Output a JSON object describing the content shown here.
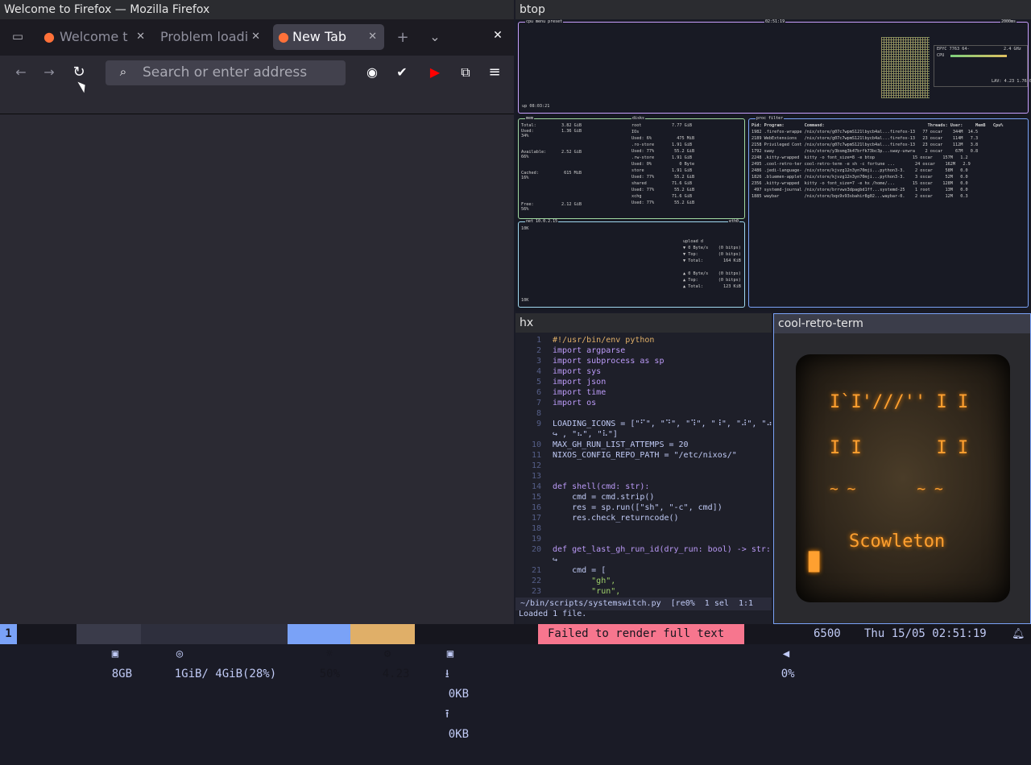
{
  "firefox": {
    "window_title": "Welcome to Firefox — Mozilla Firefox",
    "tabs": [
      {
        "label": "Welcome t",
        "active": false
      },
      {
        "label": "Problem loadi",
        "active": false
      },
      {
        "label": "New Tab",
        "active": true
      }
    ],
    "address_placeholder": "Search or enter address",
    "icons": [
      "tab-overview-icon",
      "firefox-icon",
      "close-icon",
      "new-tab-icon",
      "list-tabs-icon",
      "close-window-icon",
      "back-icon",
      "forward-icon",
      "reload-icon",
      "search-icon",
      "account-icon",
      "extension-icon",
      "youtube-icon",
      "puzzle-icon",
      "menu-icon"
    ]
  },
  "btop": {
    "window_title": "btop",
    "cpu": {
      "model": "EPYC 7763 64-",
      "freq": "2.4 GHz",
      "uptime": "up 08:03:21",
      "clock": "02:51:19",
      "load": "LAV: 4.23 1.76 0.60",
      "header_right": "2000ms"
    },
    "mem": {
      "lines": [
        "Total:          3.82 GiB",
        "Used:           1.36 GiB",
        "34%",
        "",
        "",
        "Available:      2.52 GiB",
        "66%",
        "",
        "",
        "Cached:          615 MiB",
        "16%",
        "",
        "",
        "",
        "",
        "Free:           2.12 GiB",
        "56%"
      ],
      "disks": [
        "root            7.77 GiB",
        "IOs",
        "Used: 6%          475 MiB",
        ".ro-store       1.91 GiB",
        "Used: 77%        55.2 GiB",
        ".rw-store       1.91 GiB",
        "Used: 0%           0 Byte",
        "store           1.91 GiB",
        "Used: 77%        55.2 GiB",
        "shared          71.6 GiB",
        "Used: 77%        55.2 GiB",
        "xchg            71.6 GiB",
        "Used: 77%        55.2 GiB"
      ]
    },
    "net": {
      "label": "net 10.0.2.15",
      "iface": "eth0",
      "scale_top": "10K",
      "scale_bottom": "10K",
      "lines": [
        "upload d",
        "▼ 0 Byte/s    (0 bitps)",
        "▼ Top:        (0 bitps)",
        "▼ Total:        164 KiB",
        "",
        "▲ 0 Byte/s    (0 bitps)",
        "▲ Top:        (0 bitps)",
        "▲ Total:        123 KiB"
      ]
    },
    "proc": {
      "header": "Pid: Program:        Command:                                         Threads: User:     MemB   Cpu%",
      "rows": [
        "1982 .firefox-wrappe /nix/store/g07c7wpmS121lbycb4al...firefox-13   77 oscar    344M  14.5",
        "2189 WebExtensions   /nix/store/g07c7wpmS121lbycb4al...firefox-13   23 oscar    114M   7.3",
        "2158 Privileged Cont /nix/store/g07c7wpmS121lbycb4al...firefox-13   23 oscar    112M   3.8",
        "1792 sway            /nix/store/y3bsmg3k47brfk73bc3p...sway-unwra    2 oscar     67M   0.8",
        "2248 .kitty-wrapped  kitty -o font_size=8 -e btop               15 oscar    157M   1.2",
        "2495 .cool-retro-ter cool-retro-term -e sh -c fortune ...        24 oscar    162M   2.9",
        "2486 .jedi-language- /nix/store/kjvzg12n3yn70mji...python3-3.    2 oscar     58M   0.0",
        "1826 .bluemen-applet /nix/store/kjvzg12n3yn70mji...python3-3.    3 oscar     52M   0.0",
        "2356 .kitty-wrapped  kitty -o font_size=7 -e hx /home/...       15 oscar    128M   0.0",
        " 497 systemd-journal /nix/store/brrvwx3dpagbd1ff...systemd-25    1 root      13M   0.0",
        "1885 waybar          /nix/store/bqs9v93sbahir8g02...waybar-0.    2 oscar     12M   0.3"
      ]
    }
  },
  "hx": {
    "window_title": "hx",
    "lines": [
      {
        "n": "1",
        "t": "#!/usr/bin/env python"
      },
      {
        "n": "2",
        "t": "import argparse"
      },
      {
        "n": "3",
        "t": "import subprocess as sp"
      },
      {
        "n": "4",
        "t": "import sys"
      },
      {
        "n": "5",
        "t": "import json"
      },
      {
        "n": "6",
        "t": "import time"
      },
      {
        "n": "7",
        "t": "import os"
      },
      {
        "n": "8",
        "t": ""
      },
      {
        "n": "9",
        "t": "LOADING_ICONS = [\"⠋\", \"⠙\", \"⠹\", \"⠸\", \"⠼\", \"⠴\""
      },
      {
        "n": "",
        "t": "↪ , \"⠦\", \"⠧\"]"
      },
      {
        "n": "10",
        "t": "MAX_GH_RUN_LIST_ATTEMPS = 20"
      },
      {
        "n": "11",
        "t": "NIXOS_CONFIG_REPO_PATH = \"/etc/nixos/\""
      },
      {
        "n": "12",
        "t": ""
      },
      {
        "n": "13",
        "t": ""
      },
      {
        "n": "14",
        "t": "def shell(cmd: str):"
      },
      {
        "n": "15",
        "t": "    cmd = cmd.strip()"
      },
      {
        "n": "16",
        "t": "    res = sp.run([\"sh\", \"-c\", cmd])"
      },
      {
        "n": "17",
        "t": "    res.check_returncode()"
      },
      {
        "n": "18",
        "t": ""
      },
      {
        "n": "19",
        "t": ""
      },
      {
        "n": "20",
        "t": "def get_last_gh_run_id(dry_run: bool) -> str:"
      },
      {
        "n": "",
        "t": "↪"
      },
      {
        "n": "21",
        "t": "    cmd = ["
      },
      {
        "n": "22",
        "t": "        \"gh\","
      },
      {
        "n": "23",
        "t": "        \"run\","
      }
    ],
    "status_file": " ~/bin/scripts/systemswitch.py  [re0%  1 sel  1:1",
    "message": "Loaded 1 file."
  },
  "crt": {
    "window_title": "cool-retro-term",
    "lines": [
      "I`I'///'' I I",
      "I I       I I",
      "~ ~       ~ ~",
      "Scowleton"
    ],
    "cursor": "█"
  },
  "statusbar": {
    "workspace": "1",
    "disk": "8GB",
    "mem": "1GiB/ 4GiB(28%)",
    "backlight": "50%",
    "load": "4.23",
    "net_down": "0KB",
    "net_up": "0KB",
    "error": "Failed to render full text",
    "volume": "0%",
    "temp": "6500",
    "datetime": "Thu 15/05 02:51:19"
  }
}
